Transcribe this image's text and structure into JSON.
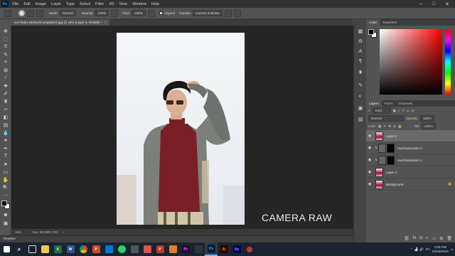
{
  "menubar": {
    "app_icon": "Ps",
    "items": [
      "File",
      "Edit",
      "Image",
      "Layer",
      "Type",
      "Select",
      "Filter",
      "3D",
      "View",
      "Window",
      "Help"
    ],
    "window_controls": [
      "minimize-icon",
      "maximize-icon",
      "close-icon"
    ]
  },
  "options_bar": {
    "mode_label": "Mode:",
    "mode_value": "Normal",
    "opacity_label": "Opacity:",
    "opacity_value": "100%",
    "flow_label": "Flow:",
    "flow_value": "100%",
    "aligned_label": "Aligned",
    "aligned_checked": true,
    "sample_label": "Sample:",
    "sample_value": "Current & Below"
  },
  "document": {
    "tab_title": "cori-lindo-1644145-unsplash2.jpg @ 16% (Layer 2, RGB/8) *",
    "zoom": "16%",
    "doc_size": "Doc: 45.0M/1.70G",
    "watermark": "CAMERA RAW"
  },
  "timeline": {
    "label": "Timeline"
  },
  "color_panel": {
    "tabs": [
      "Color",
      "Swatches"
    ],
    "foreground": "#000000",
    "background": "#ffffff"
  },
  "layers_panel": {
    "tabs": [
      "Layers",
      "Paths",
      "Channels"
    ],
    "filter_label": "Kind",
    "blend_mode": "Normal",
    "opacity_label": "Opacity:",
    "opacity_value": "100%",
    "lock_label": "Lock:",
    "fill_label": "Fill:",
    "fill_value": "100%",
    "layers": [
      {
        "name": "Layer 2",
        "selected": true,
        "visible": true
      },
      {
        "name": "Hue/Saturation 2",
        "selected": false,
        "visible": true
      },
      {
        "name": "Hue/Saturation 1",
        "selected": false,
        "visible": true
      },
      {
        "name": "Layer 1",
        "selected": false,
        "visible": true
      },
      {
        "name": "Background",
        "selected": false,
        "visible": true
      }
    ]
  },
  "taskbar": {
    "apps": [
      {
        "name": "start-icon"
      },
      {
        "name": "search-icon"
      },
      {
        "name": "task-view-icon"
      },
      {
        "name": "file-explorer-icon"
      },
      {
        "name": "excel-icon",
        "label": "X"
      },
      {
        "name": "word-icon",
        "label": "W"
      },
      {
        "name": "chrome-icon"
      },
      {
        "name": "powerpoint-icon",
        "label": "P"
      },
      {
        "name": "store-icon"
      },
      {
        "name": "whatsapp-icon"
      },
      {
        "name": "app-icon"
      },
      {
        "name": "app-icon-2"
      },
      {
        "name": "pdf-icon",
        "label": "P"
      },
      {
        "name": "app-icon-3"
      },
      {
        "name": "premiere-icon",
        "label": "Pr"
      },
      {
        "name": "app-icon-4"
      },
      {
        "name": "photoshop-icon",
        "label": "Ps",
        "active": true
      },
      {
        "name": "illustrator-icon",
        "label": "Ai"
      },
      {
        "name": "after-effects-icon",
        "label": "Ae"
      },
      {
        "name": "record-icon"
      }
    ],
    "language": "FA",
    "time": "1:05 PM",
    "date": "10/16/2019"
  }
}
